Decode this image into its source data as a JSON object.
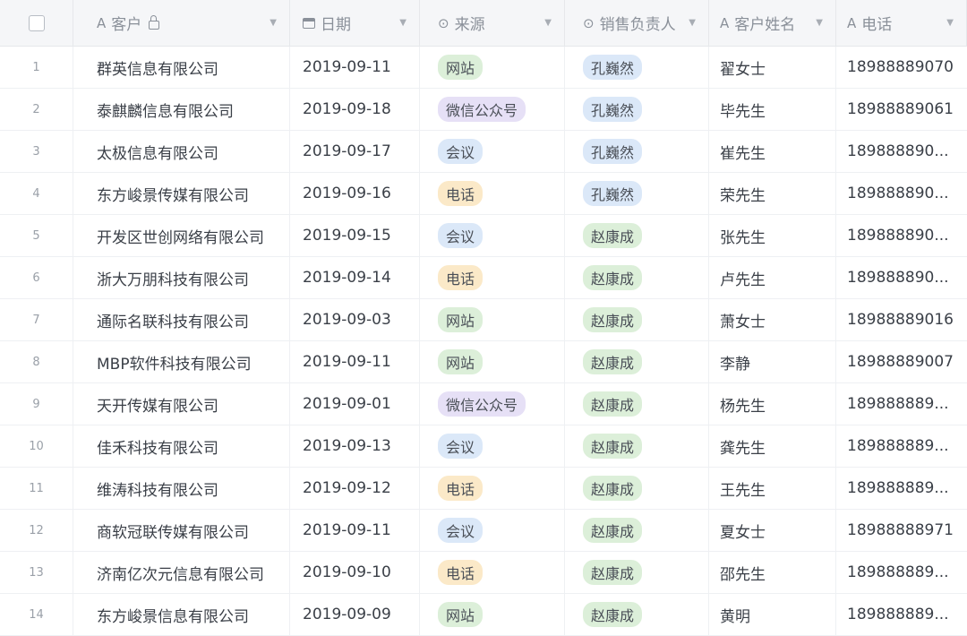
{
  "header": {
    "customer": "客户",
    "date": "日期",
    "source": "来源",
    "owner": "销售负责人",
    "customer_name": "客户姓名",
    "phone": "电话",
    "text_icon": "A",
    "single_select_icon": "⊙"
  },
  "rows": [
    {
      "num": "1",
      "customer": "群英信息有限公司",
      "date": "2019-09-11",
      "source": "网站",
      "owner": "孔巍然",
      "name": "翟女士",
      "phone": "18988889070"
    },
    {
      "num": "2",
      "customer": "泰麒麟信息有限公司",
      "date": "2019-09-18",
      "source": "微信公众号",
      "owner": "孔巍然",
      "name": "毕先生",
      "phone": "18988889061"
    },
    {
      "num": "3",
      "customer": "太极信息有限公司",
      "date": "2019-09-17",
      "source": "会议",
      "owner": "孔巍然",
      "name": "崔先生",
      "phone": "189888890..."
    },
    {
      "num": "4",
      "customer": "东方峻景传媒有限公司",
      "date": "2019-09-16",
      "source": "电话",
      "owner": "孔巍然",
      "name": "荣先生",
      "phone": "189888890..."
    },
    {
      "num": "5",
      "customer": "开发区世创网络有限公司",
      "date": "2019-09-15",
      "source": "会议",
      "owner": "赵康成",
      "name": "张先生",
      "phone": "189888890..."
    },
    {
      "num": "6",
      "customer": "浙大万朋科技有限公司",
      "date": "2019-09-14",
      "source": "电话",
      "owner": "赵康成",
      "name": "卢先生",
      "phone": "189888890..."
    },
    {
      "num": "7",
      "customer": "通际名联科技有限公司",
      "date": "2019-09-03",
      "source": "网站",
      "owner": "赵康成",
      "name": "萧女士",
      "phone": "18988889016"
    },
    {
      "num": "8",
      "customer": "MBP软件科技有限公司",
      "date": "2019-09-11",
      "source": "网站",
      "owner": "赵康成",
      "name": "李静",
      "phone": "18988889007"
    },
    {
      "num": "9",
      "customer": "天开传媒有限公司",
      "date": "2019-09-01",
      "source": "微信公众号",
      "owner": "赵康成",
      "name": "杨先生",
      "phone": "189888889..."
    },
    {
      "num": "10",
      "customer": "佳禾科技有限公司",
      "date": "2019-09-13",
      "source": "会议",
      "owner": "赵康成",
      "name": "龚先生",
      "phone": "189888889..."
    },
    {
      "num": "11",
      "customer": "维涛科技有限公司",
      "date": "2019-09-12",
      "source": "电话",
      "owner": "赵康成",
      "name": "王先生",
      "phone": "189888889..."
    },
    {
      "num": "12",
      "customer": "商软冠联传媒有限公司",
      "date": "2019-09-11",
      "source": "会议",
      "owner": "赵康成",
      "name": "夏女士",
      "phone": "18988888971"
    },
    {
      "num": "13",
      "customer": "济南亿次元信息有限公司",
      "date": "2019-09-10",
      "source": "电话",
      "owner": "赵康成",
      "name": "邵先生",
      "phone": "189888889..."
    },
    {
      "num": "14",
      "customer": "东方峻景信息有限公司",
      "date": "2019-09-09",
      "source": "网站",
      "owner": "赵康成",
      "name": "黄明",
      "phone": "189888889..."
    }
  ],
  "source_colors": {
    "网站": "#dcefd9",
    "微信公众号": "#e6e0f6",
    "会议": "#dbe8f8",
    "电话": "#fbe9c8"
  },
  "owner_colors": {
    "孔巍然": "#dbe8f8",
    "赵康成": "#dcefd9"
  }
}
